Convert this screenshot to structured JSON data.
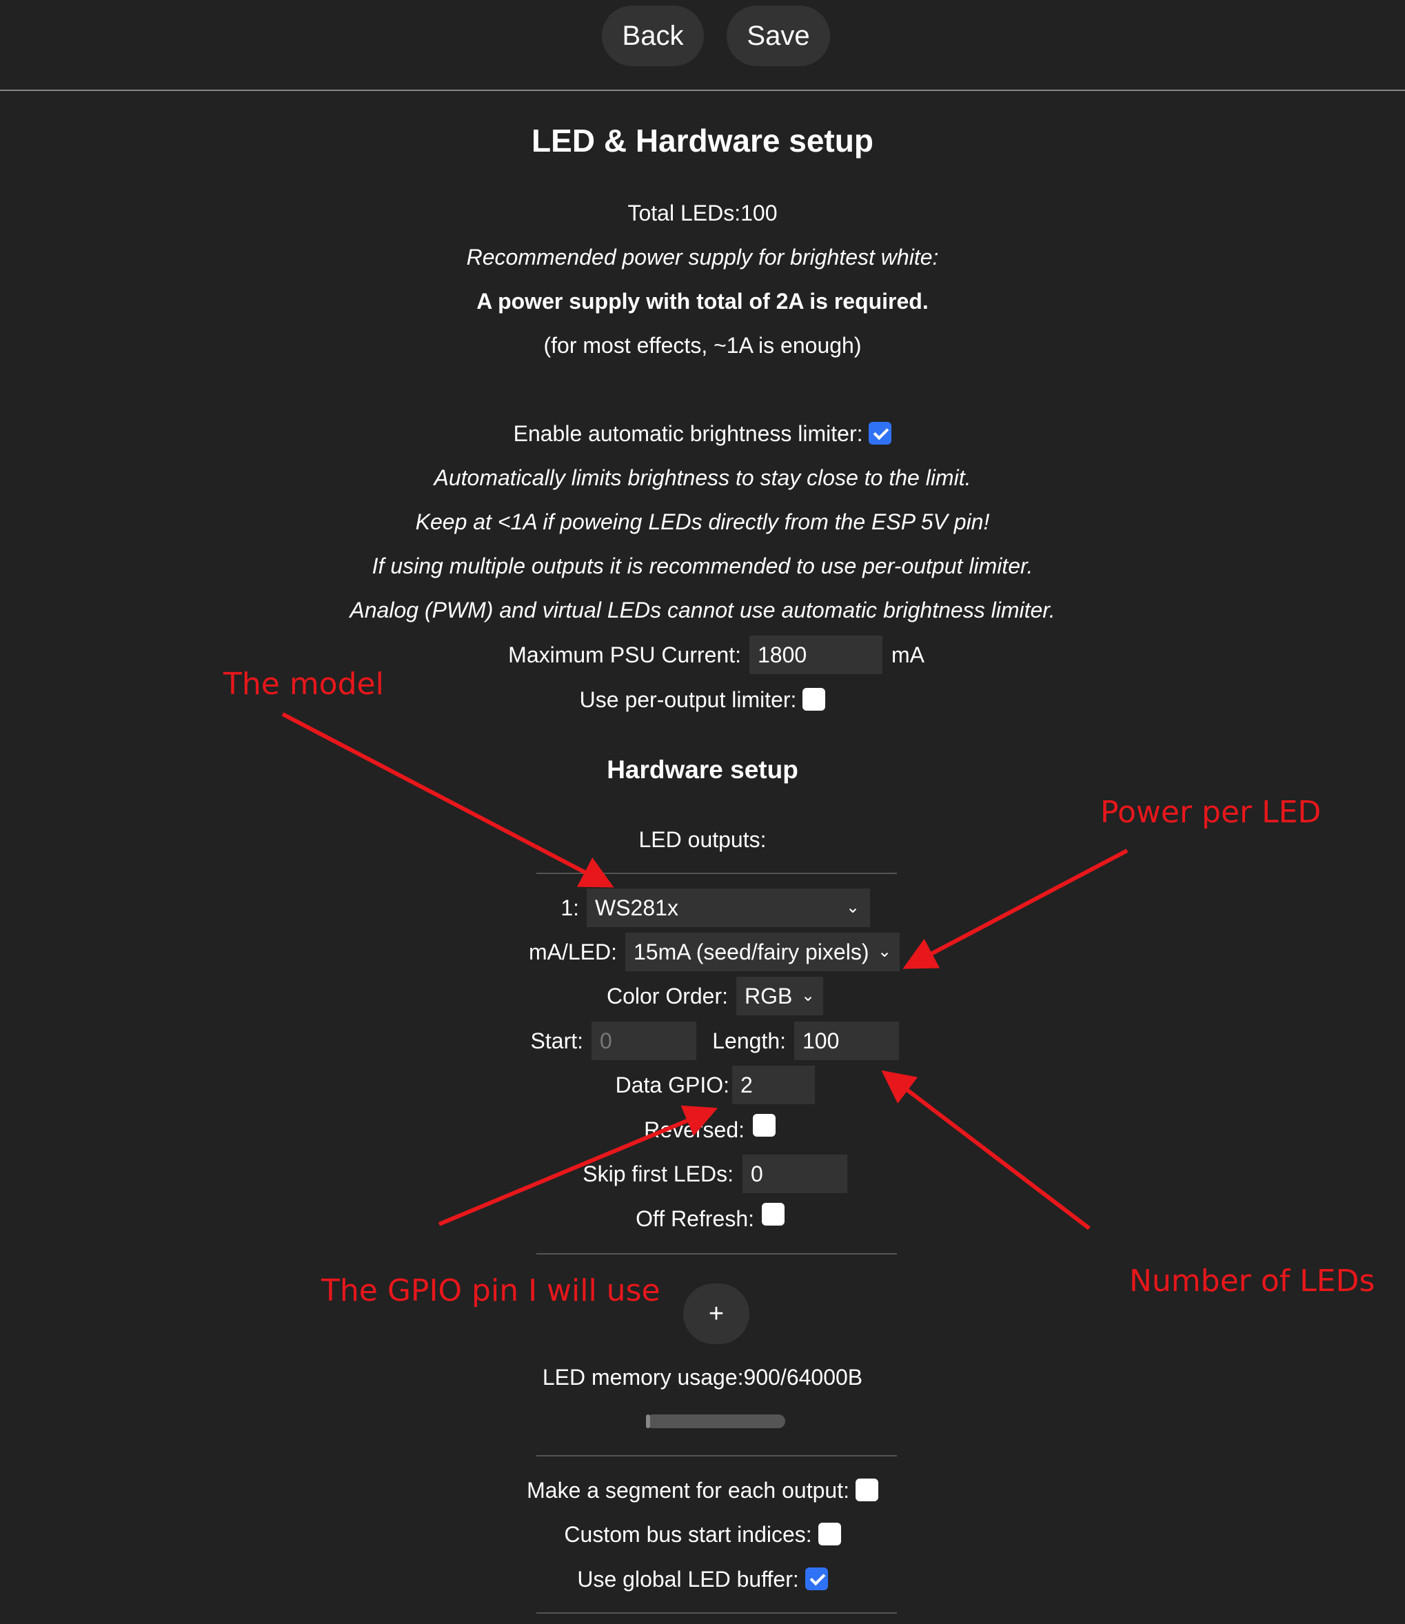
{
  "toolbar": {
    "back_label": "Back",
    "save_label": "Save"
  },
  "page_title": "LED & Hardware setup",
  "power": {
    "total_leds": "Total LEDs:100",
    "recommend_label": "Recommended power supply for brightest white:",
    "requirement": "A power supply with total of 2A is required.",
    "most_effects": "(for most effects, ~1A is enough)",
    "abl_label": "Enable automatic brightness limiter:",
    "abl_checked": true,
    "notes": [
      "Automatically limits brightness to stay close to the limit.",
      "Keep at <1A if poweing LEDs directly from the ESP 5V pin!",
      "If using multiple outputs it is recommended to use per-output limiter.",
      "Analog (PWM) and virtual LEDs cannot use automatic brightness limiter."
    ],
    "max_psu_label": "Maximum PSU Current:",
    "max_psu_value": "1800",
    "max_psu_unit": "mA",
    "per_output_label": "Use per-output limiter:",
    "per_output_checked": false
  },
  "hardware": {
    "title": "Hardware setup",
    "outputs_label": "LED outputs:",
    "output": {
      "index_label": "1:",
      "type": "WS281x",
      "ma_label": "mA/LED:",
      "ma_value": "15mA (seed/fairy pixels)",
      "color_order_label": "Color Order:",
      "color_order_value": "RGB",
      "start_label": "Start:",
      "start_value": "0",
      "length_label": "Length:",
      "length_value": "100",
      "gpio_label": "Data GPIO:",
      "gpio_value": "2",
      "reversed_label": "Reversed:",
      "reversed_checked": false,
      "skip_label": "Skip first LEDs:",
      "skip_value": "0",
      "off_refresh_label": "Off Refresh:",
      "off_refresh_checked": false
    },
    "add_label": "+",
    "memory_usage": "LED memory usage:900/64000B",
    "memory_fraction": 0.014,
    "segment_each_label": "Make a segment for each output:",
    "segment_each_checked": false,
    "custom_bus_label": "Custom bus start indices:",
    "custom_bus_checked": false,
    "global_buffer_label": "Use global LED buffer:",
    "global_buffer_checked": true
  },
  "annotations": {
    "model": "The model",
    "power_per_led": "Power per LED",
    "gpio_pin": "The GPIO pin I will use",
    "num_leds": "Number of LEDs",
    "color": "#e8171b"
  }
}
